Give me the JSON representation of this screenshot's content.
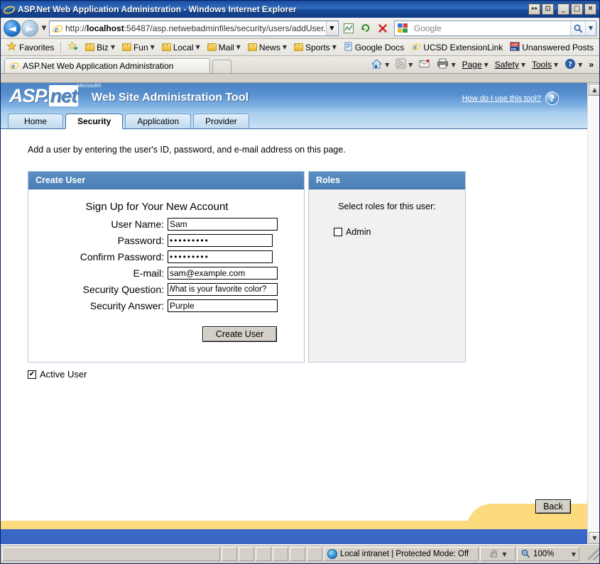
{
  "window": {
    "title": "ASP.Net Web Application Administration - Windows Internet Explorer",
    "buttons": {
      "restore_split": "↔",
      "restore_small": "⊡",
      "minimize": "_",
      "maximize": "□",
      "close": "✕"
    }
  },
  "navbar": {
    "back_glyph": "◄",
    "forward_glyph": "►",
    "history_caret": "▼",
    "url_prefix": "http://",
    "url_host": "localhost",
    "url_rest": ":56487/asp.netwebadminfiles/security/users/addUser.",
    "address_caret": "▼",
    "buttons": [
      {
        "name": "compatibility-view-button",
        "glyph": "▨"
      },
      {
        "name": "refresh-button",
        "glyph": "↻"
      },
      {
        "name": "stop-button",
        "glyph": "✕"
      }
    ],
    "search_placeholder": "Google",
    "search_go_glyph": "⌕",
    "search_caret": "▼"
  },
  "favorites": {
    "label": "Favorites",
    "items": [
      {
        "label": "Biz",
        "type": "folder",
        "caret": "▼"
      },
      {
        "label": "Fun",
        "type": "folder",
        "caret": "▼"
      },
      {
        "label": "Local",
        "type": "folder",
        "caret": "▼"
      },
      {
        "label": "Mail",
        "type": "folder",
        "caret": "▼"
      },
      {
        "label": "News",
        "type": "folder",
        "caret": "▼"
      },
      {
        "label": "Sports",
        "type": "folder",
        "caret": "▼"
      },
      {
        "label": "Google Docs",
        "type": "link"
      },
      {
        "label": "UCSD ExtensionLink",
        "type": "link"
      },
      {
        "label": "Unanswered Posts",
        "type": "link"
      }
    ]
  },
  "browser_tabs": {
    "active_tab": "ASP.Net Web Application Administration"
  },
  "command_bar": {
    "items": [
      {
        "name": "home-button",
        "label": "",
        "caret": "▼"
      },
      {
        "name": "feeds-button",
        "label": "",
        "caret": "▼"
      },
      {
        "name": "read-mail-button",
        "label": "",
        "caret": ""
      },
      {
        "name": "print-button",
        "label": "",
        "caret": "▼"
      },
      {
        "name": "page-menu",
        "label": "Page",
        "caret": "▼"
      },
      {
        "name": "safety-menu",
        "label": "Safety",
        "caret": "▼"
      },
      {
        "name": "tools-menu",
        "label": "Tools",
        "caret": "▼"
      },
      {
        "name": "help-menu",
        "label": "",
        "caret": "▼"
      }
    ],
    "overflow": "»"
  },
  "banner": {
    "logo_asp": "ASP",
    "logo_dot": ".",
    "logo_net": "net",
    "trademark": "Microsoft®",
    "title": "Web Site Administration Tool",
    "help_link": "How do I use this tool?",
    "help_icon": "?"
  },
  "asp_tabs": [
    {
      "label": "Home",
      "active": false
    },
    {
      "label": "Security",
      "active": true
    },
    {
      "label": "Application",
      "active": false
    },
    {
      "label": "Provider",
      "active": false
    }
  ],
  "content": {
    "intro": "Add a user by entering the user's ID, password, and e-mail address on this page.",
    "create_user_panel": {
      "header": "Create User",
      "signup_title": "Sign Up for Your New Account",
      "fields": [
        {
          "name": "user-name",
          "label": "User Name:",
          "value": "Sam",
          "type": "text"
        },
        {
          "name": "password",
          "label": "Password:",
          "value": "•••••••••",
          "type": "password"
        },
        {
          "name": "confirm-password",
          "label": "Confirm Password:",
          "value": "•••••••••",
          "type": "password"
        },
        {
          "name": "email",
          "label": "E-mail:",
          "value": "sam@example.com",
          "type": "text"
        },
        {
          "name": "security-question",
          "label": "Security Question:",
          "value": "What is your favorite color?",
          "type": "text"
        },
        {
          "name": "security-answer",
          "label": "Security Answer:",
          "value": "Purple",
          "type": "text"
        }
      ],
      "submit_label": "Create User"
    },
    "roles_panel": {
      "header": "Roles",
      "subtitle": "Select roles for this user:",
      "roles": [
        {
          "label": "Admin",
          "checked": false
        }
      ]
    },
    "active_user": {
      "label": "Active User",
      "checked": true,
      "mark": "✔"
    },
    "back_label": "Back"
  },
  "scrollbar": {
    "up_glyph": "▲",
    "down_glyph": "▼"
  },
  "statusbar": {
    "zone": "Local intranet | Protected Mode: Off",
    "protected_caret": "▼",
    "zoom": "100%",
    "zoom_caret": "▼",
    "zoom_glyph": "⌕"
  },
  "colors": {
    "title_blue": "#1c4d9e",
    "banner_blue": "#4b83c4",
    "panel_header": "#5b8fc4",
    "footer_yellow": "#fbdb7e",
    "footer_blue": "#3a66c4",
    "chrome_gray": "#d4d0c8"
  }
}
